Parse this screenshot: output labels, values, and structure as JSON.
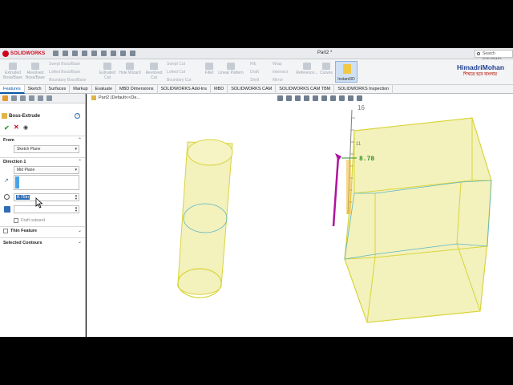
{
  "app": {
    "name": "SOLIDWORKS",
    "document_title": "Part2 *"
  },
  "search": {
    "placeholder": "Search SOLIDWO"
  },
  "brand": {
    "name": "HimadriMohan",
    "sub": "শিখতে হবে বাংলায়"
  },
  "ribbon": {
    "large": [
      {
        "label": "Extruded Boss/Base"
      },
      {
        "label": "Revolved Boss/Base"
      },
      {
        "label": "Extruded Cut"
      },
      {
        "label": "Hole Wizard"
      },
      {
        "label": "Revolved Cut"
      },
      {
        "label": "Fillet"
      },
      {
        "label": "Linear Pattern"
      },
      {
        "label": "Reference..."
      },
      {
        "label": "Curves"
      }
    ],
    "small": [
      "Swept Boss/Base",
      "Lofted Boss/Base",
      "Boundary Boss/Base",
      "Swept Cut",
      "Lofted Cut",
      "Boundary Cut",
      "Rib",
      "Draft",
      "Shell",
      "Wrap",
      "Intersect",
      "Mirror"
    ],
    "instant3d": "Instant3D"
  },
  "tabs": [
    "Features",
    "Sketch",
    "Surfaces",
    "Markup",
    "Evaluate",
    "MBD Dimensions",
    "SOLIDWORKS Add-Ins",
    "MBD",
    "SOLIDWORKS CAM",
    "SOLIDWORKS CAM TBM",
    "SOLIDWORKS Inspection"
  ],
  "property_manager": {
    "title": "Boss-Extrude",
    "help": "?",
    "ok_symbol": "✔",
    "cancel_symbol": "✕",
    "from_label": "From",
    "from_value": "Sketch Plane",
    "direction_label": "Direction 1",
    "direction_value": "Mid Plane",
    "depth_value": "8.75in",
    "draft_label": "Draft outward",
    "thin_label": "Thin Feature",
    "contours_label": "Selected Contours"
  },
  "viewport": {
    "tree_label": "Part2 (Default<<De...",
    "dimension_value": "8.78",
    "ruler_top": "16",
    "ruler_mid": "11"
  },
  "colors": {
    "accent": "#0b56a4",
    "brand_red": "#d0021b",
    "model_fill": "#f1efb0",
    "model_edge": "#d8d53a",
    "arrow": "#b0129e"
  }
}
